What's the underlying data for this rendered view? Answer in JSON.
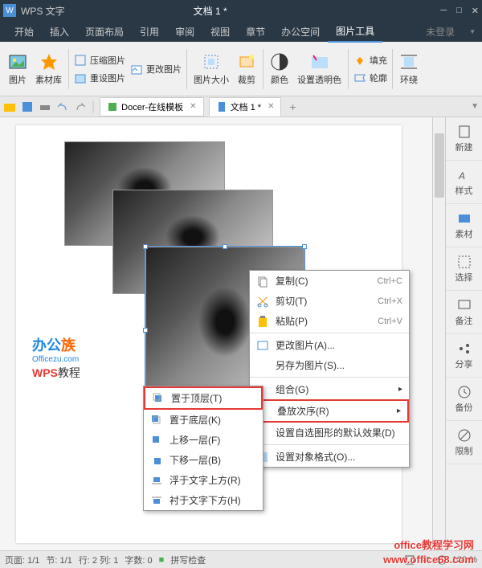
{
  "titlebar": {
    "app_name": "WPS 文字",
    "document": "文档 1 *"
  },
  "menubar": {
    "items": [
      "开始",
      "插入",
      "页面布局",
      "引用",
      "审阅",
      "视图",
      "章节",
      "办公空间",
      "图片工具"
    ],
    "login": "未登录"
  },
  "ribbon": {
    "picture": "图片",
    "material": "素材库",
    "compress": "压缩图片",
    "change": "更改图片",
    "reset": "重设图片",
    "size": "图片大小",
    "crop": "裁剪",
    "color": "颜色",
    "transparent": "设置透明色",
    "fill": "填充",
    "outline": "轮廓",
    "wrap": "环绕"
  },
  "tabs": {
    "docer": "Docer-在线模板",
    "doc1": "文档 1 *"
  },
  "sidepanel": {
    "new": "新建",
    "style": "样式",
    "material": "素材",
    "select": "选择",
    "comment": "备注",
    "share": "分享",
    "backup": "备份",
    "limit": "限制"
  },
  "watermark": {
    "brand1": "办公",
    "brand2": "族",
    "sub": "Officezu.com",
    "wps": "WPS",
    "tutorial": "教程"
  },
  "context_menu": {
    "copy": "复制(C)",
    "cut": "剪切(T)",
    "paste": "粘贴(P)",
    "change_pic": "更改图片(A)...",
    "save_as": "另存为图片(S)...",
    "group": "组合(G)",
    "order": "叠放次序(R)",
    "default_effect": "设置自选图形的默认效果(D)",
    "format": "设置对象格式(O)...",
    "copy_key": "Ctrl+C",
    "cut_key": "Ctrl+X",
    "paste_key": "Ctrl+V"
  },
  "submenu": {
    "bring_front": "置于顶层(T)",
    "send_back": "置于底层(K)",
    "forward": "上移一层(F)",
    "backward": "下移一层(B)",
    "above_text": "浮于文字上方(R)",
    "below_text": "衬于文字下方(H)"
  },
  "statusbar": {
    "page": "页面: 1/1",
    "section": "节: 1/1",
    "row_col": "行: 2 列: 1",
    "chars": "字数: 0",
    "spell": "拼写检查",
    "zoom": "100 %"
  },
  "footer_watermark": {
    "line1": "office教程学习网",
    "line2": "www.office68.com"
  }
}
